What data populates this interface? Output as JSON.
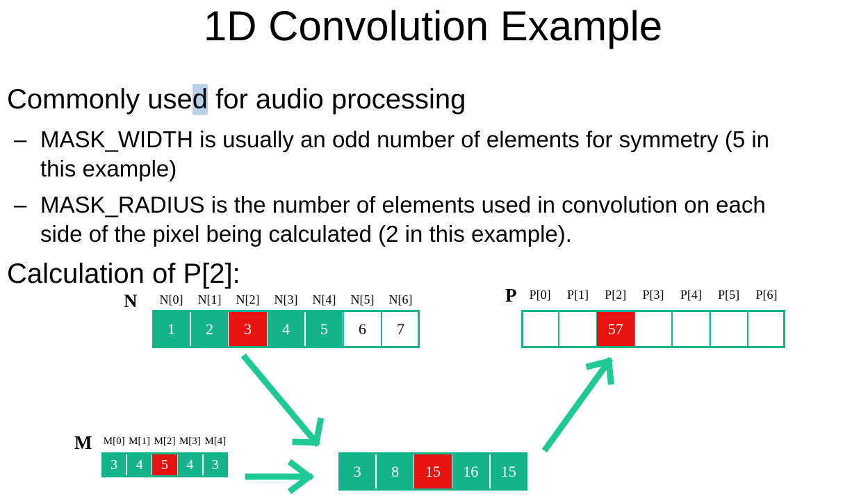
{
  "slide": {
    "title": "1D Convolution Example",
    "intro_before": "Commonly use",
    "intro_selected": "d",
    "intro_after": " for audio processing",
    "bullets": [
      {
        "dash": "–",
        "line1": "MASK_WIDTH is usually an odd number of elements for symmetry (5 in",
        "line2": "this example)"
      },
      {
        "dash": "–",
        "line1": "MASK_RADIUS is the number of elements used in convolution on each",
        "line2": "side of the pixel being calculated (2 in this example)."
      }
    ],
    "calc_label": "Calculation of P[2]:"
  },
  "colors": {
    "green": "#15b38a",
    "red": "#e8120f",
    "white": "#ffffff",
    "arrow": "#1fc996",
    "selection": "#b8d0e8"
  },
  "arrays": {
    "N": {
      "name": "N",
      "labels": [
        "N[0]",
        "N[1]",
        "N[2]",
        "N[3]",
        "N[4]",
        "N[5]",
        "N[6]"
      ],
      "values": [
        "1",
        "2",
        "3",
        "4",
        "5",
        "6",
        "7"
      ],
      "fills": [
        "green",
        "green",
        "red",
        "green",
        "green",
        "white",
        "white"
      ]
    },
    "M": {
      "name": "M",
      "labels": [
        "M[0]",
        "M[1]",
        "M[2]",
        "M[3]",
        "M[4]"
      ],
      "values": [
        "3",
        "4",
        "5",
        "4",
        "3"
      ],
      "fills": [
        "green",
        "green",
        "red",
        "green",
        "green"
      ]
    },
    "products": {
      "values": [
        "3",
        "8",
        "15",
        "16",
        "15"
      ],
      "fills": [
        "green",
        "green",
        "red",
        "green",
        "green"
      ]
    },
    "P": {
      "name": "P",
      "labels": [
        "P[0]",
        "P[1]",
        "P[2]",
        "P[3]",
        "P[4]",
        "P[5]",
        "P[6]"
      ],
      "values": [
        "",
        "",
        "57",
        "",
        "",
        "",
        ""
      ],
      "fills": [
        "white",
        "white",
        "red",
        "white",
        "white",
        "white",
        "white"
      ]
    }
  }
}
